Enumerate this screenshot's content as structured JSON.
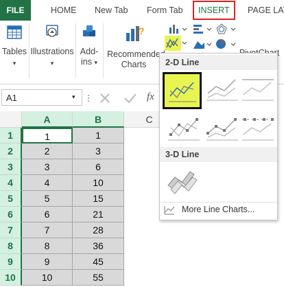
{
  "ribbon_tabs": {
    "file": "FILE",
    "home": "HOME",
    "new_tab": "New Tab",
    "form_tab": "Form Tab",
    "insert": "INSERT",
    "page_layout": "PAGE LAY"
  },
  "ribbon": {
    "tables": "Tables",
    "illustrations": "Illustrations",
    "addins_line1": "Add-",
    "addins_line2": "ins",
    "recommended_line1": "Recommended",
    "recommended_line2": "Charts",
    "pivotchart": "PivotChart"
  },
  "formula_bar": {
    "name_box": "A1",
    "fx": "fx"
  },
  "sheet": {
    "columns": [
      "A",
      "B",
      "C"
    ],
    "rows": [
      {
        "row": "1",
        "a": "1",
        "b": "1"
      },
      {
        "row": "2",
        "a": "2",
        "b": "3"
      },
      {
        "row": "3",
        "a": "3",
        "b": "6"
      },
      {
        "row": "4",
        "a": "4",
        "b": "10"
      },
      {
        "row": "5",
        "a": "5",
        "b": "15"
      },
      {
        "row": "6",
        "a": "6",
        "b": "21"
      },
      {
        "row": "7",
        "a": "7",
        "b": "28"
      },
      {
        "row": "8",
        "a": "8",
        "b": "36"
      },
      {
        "row": "9",
        "a": "9",
        "b": "45"
      },
      {
        "row": "10",
        "a": "10",
        "b": "55"
      }
    ]
  },
  "line_menu": {
    "section_2d": "2-D Line",
    "section_3d": "3-D Line",
    "more": "More Line Charts..."
  },
  "colors": {
    "excel_green": "#217346",
    "highlight": "#e8f550",
    "insert_outline": "#e02020"
  }
}
